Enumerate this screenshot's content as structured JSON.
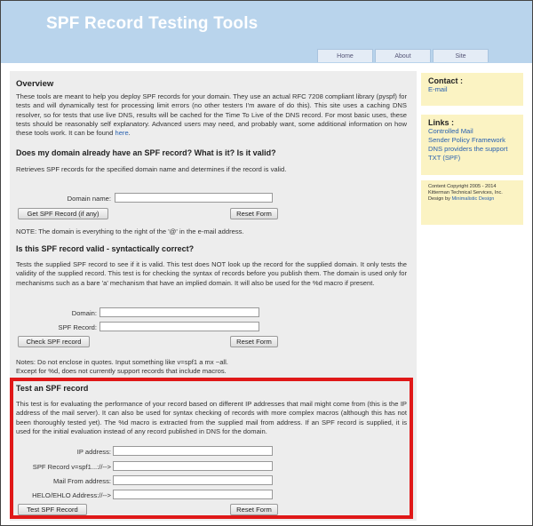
{
  "header": {
    "title": "SPF Record Testing Tools",
    "nav": [
      "Home",
      "About",
      "Site"
    ]
  },
  "overview": {
    "heading": "Overview",
    "text": "These tools are meant to help you deploy SPF records for your domain. They use an actual RFC 7208 compliant library (pyspf) for tests and will dynamically test for processing limit errors (no other testers I'm aware of do this). This site uses a caching DNS resolver, so for tests that use live DNS, results will be cached for the Time To Live of the DNS record. For most basic uses, these tests should be reasonably self explanatory. Advanced users may need, and probably want, some additional information on how these tools work. It can be found",
    "link": "here",
    "after_link": "."
  },
  "section1": {
    "heading": "Does my domain already have an SPF record? What is it? Is it valid?",
    "text": "Retrieves SPF records for the specified domain name and determines if the record is valid.",
    "domain_label": "Domain name:",
    "submit": "Get SPF Record (if any)",
    "reset": "Reset Form",
    "note": "NOTE: The domain is everything to the right of the '@' in the e-mail address."
  },
  "section2": {
    "heading": "Is this SPF record valid - syntactically correct?",
    "text": "Tests the supplied SPF record to see if it is valid. This test does NOT look up the record for the supplied domain. It only tests the validity of the supplied record. This test is for checking the syntax of records before you publish them. The domain is used only for mechanisms such as a bare 'a' mechanism that have an implied domain. It will also be used for the %d macro if present.",
    "domain_label": "Domain:",
    "record_label": "SPF Record:",
    "submit": "Check SPF record",
    "reset": "Reset Form",
    "notes_line1": "Notes: Do not enclose in quotes. Input something like v=spf1 a mx ~all.",
    "notes_line2": "Except for %d, does not currently support records that include macros."
  },
  "section3": {
    "heading": "Test an SPF record",
    "text": "This test is for evaluating the performance of your record based on different IP addresses that mail might come from (this is the IP address of the mail server). It can also be used for syntax checking of records with more complex macros (although this has not been thoroughly tested yet). The %d macro is extracted from the supplied mail from address. If an SPF record is supplied, it is used for the initial evaluation instead of any record published in DNS for the domain.",
    "ip_label": "IP address:",
    "record_label": "SPF Record v=spf1...://-->",
    "mailfrom_label": "Mail From address:",
    "helo_label": "HELO/EHLO Address://-->",
    "submit": "Test SPF Record",
    "reset": "Reset Form"
  },
  "sidebar": {
    "contact_heading": "Contact :",
    "contact_link": "E-mail",
    "links_heading": "Links :",
    "links": [
      "Controlled Mail",
      "Sender Policy Framework",
      "DNS providers the support TXT (SPF)"
    ],
    "copyright": "Content Copyright 2005 - 2014 Kitterman Technical Services, Inc.",
    "design_prefix": "Design by",
    "design_link": "Minimalistic Design"
  },
  "colors": {
    "header_bg": "#b9d4ec",
    "main_bg": "#ededed",
    "sidebar_bg": "#fbf3c3",
    "highlight_border": "#e01818",
    "link": "#2a62b0"
  }
}
